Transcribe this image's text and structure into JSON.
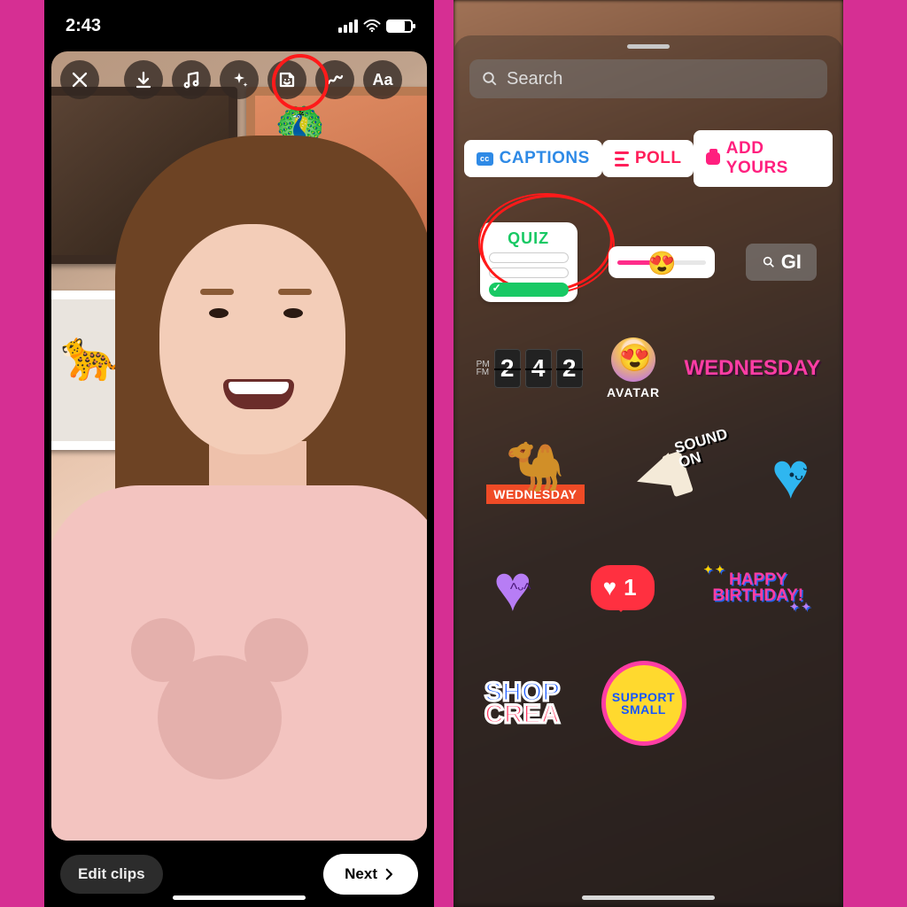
{
  "status": {
    "time": "2:43"
  },
  "toolbar": {
    "icons": [
      "close",
      "download",
      "music",
      "sparkle",
      "sticker",
      "scribble",
      "text"
    ]
  },
  "bottom": {
    "edit": "Edit clips",
    "next": "Next"
  },
  "sheet": {
    "search_placeholder": "Search",
    "chips": {
      "captions": "CAPTIONS",
      "cc": "cc",
      "poll": "POLL",
      "add_yours": "ADD YOURS"
    },
    "quiz": "QUIZ",
    "gif": "GI",
    "clock": {
      "ampm_top": "PM",
      "ampm_bottom": "FM",
      "digits": [
        "2",
        "4",
        "2"
      ]
    },
    "avatar": "AVATAR",
    "wednesday": "WEDNESDAY",
    "camel_label": "WEDNESDAY",
    "sound": {
      "l1": "SOUND",
      "l2": "ON"
    },
    "like_count": "1",
    "happy": {
      "l1": "HAPPY",
      "l2": "BIRTHDAY!"
    },
    "shop": {
      "l1": "SHOP",
      "l2": "CREA"
    },
    "support": {
      "l1": "SUPPORT",
      "l2": "SMALL"
    }
  }
}
